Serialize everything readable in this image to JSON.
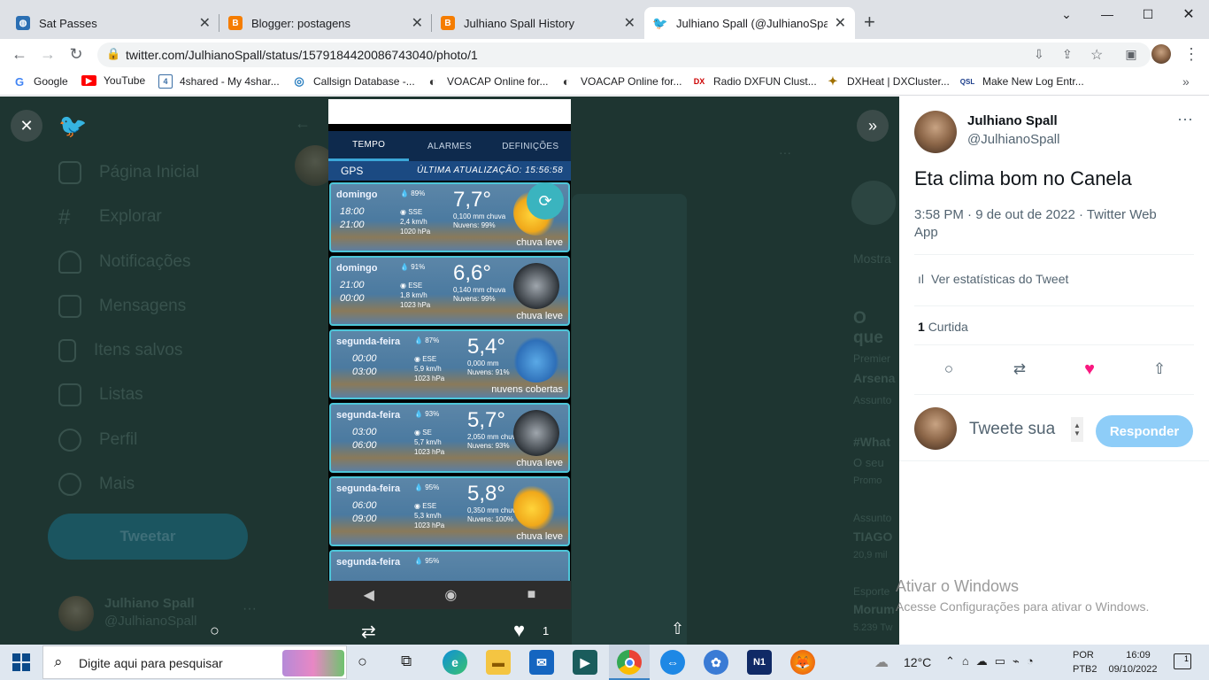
{
  "browser": {
    "tabs": [
      {
        "title": "Sat Passes",
        "icon": "globe-icon"
      },
      {
        "title": "Blogger: postagens",
        "icon": "blogger-icon"
      },
      {
        "title": "Julhiano Spall History",
        "icon": "blogger-icon"
      },
      {
        "title": "Julhiano Spall (@JulhianoSpall) /",
        "icon": "twitter-icon",
        "active": true
      }
    ],
    "new_tab": "+",
    "url": "twitter.com/JulhianoSpall/status/1579184420086743040/photo/1",
    "bookmarks": [
      {
        "label": "Google",
        "icon": "G"
      },
      {
        "label": "YouTube",
        "icon": "▶"
      },
      {
        "label": "4shared - My 4shar...",
        "icon": "4"
      },
      {
        "label": "Callsign Database -...",
        "icon": "◎"
      },
      {
        "label": "VOACAP Online for...",
        "icon": "◐"
      },
      {
        "label": "VOACAP Online for...",
        "icon": "◐"
      },
      {
        "label": "Radio DXFUN Clust...",
        "icon": "DX"
      },
      {
        "label": "DXHeat | DXCluster...",
        "icon": "✦"
      },
      {
        "label": "Make New Log Entr...",
        "icon": "QSL"
      }
    ]
  },
  "twitter_bg": {
    "nav": [
      "Página Inicial",
      "Explorar",
      "Notificações",
      "Mensagens",
      "Itens salvos",
      "Listas",
      "Perfil",
      "Mais"
    ],
    "tweet_button": "Tweetar",
    "account_name": "Julhiano Spall",
    "account_handle": "@JulhianoSpall",
    "right_fragments": [
      "Mostra",
      "O que",
      "Premier",
      "Arsena",
      "Assunto",
      "#What",
      "O seu",
      "Promo",
      "Assunto",
      "TIAGO",
      "20,9 mil",
      "Esporte",
      "Morum",
      "5.239 Tw"
    ]
  },
  "photo_actions": {
    "likes": "1"
  },
  "weather_app": {
    "tabs": [
      "TEMPO",
      "ALARMES",
      "DEFINIÇÕES"
    ],
    "gps_label": "GPS",
    "last_update": "ÚLTIMA ATUALIZAÇÃO: 15:56:58",
    "forecasts": [
      {
        "day": "domingo",
        "from": "18:00",
        "to": "21:00",
        "humidity": "89%",
        "wind_dir": "SSE",
        "wind_speed": "2,4 km/h",
        "pressure": "1020 hPa",
        "temp": "7,7°",
        "rain": "0,100 mm chuva",
        "clouds": "Nuvens: 99%",
        "condition": "chuva leve",
        "icon": "sun-rain-icon"
      },
      {
        "day": "domingo",
        "from": "21:00",
        "to": "00:00",
        "humidity": "91%",
        "wind_dir": "ESE",
        "wind_speed": "1,8 km/h",
        "pressure": "1023 hPa",
        "temp": "6,6°",
        "rain": "0,140 mm chuva",
        "clouds": "Nuvens: 99%",
        "condition": "chuva leve",
        "icon": "moon-rain-icon"
      },
      {
        "day": "segunda-feira",
        "from": "00:00",
        "to": "03:00",
        "humidity": "87%",
        "wind_dir": "ESE",
        "wind_speed": "5,9 km/h",
        "pressure": "1023 hPa",
        "temp": "5,4°",
        "rain": "0,000 mm",
        "clouds": "Nuvens: 91%",
        "condition": "nuvens cobertas",
        "icon": "clouds-icon"
      },
      {
        "day": "segunda-feira",
        "from": "03:00",
        "to": "06:00",
        "humidity": "93%",
        "wind_dir": "SE",
        "wind_speed": "5,7 km/h",
        "pressure": "1023 hPa",
        "temp": "5,7°",
        "rain": "2,050 mm chuva",
        "clouds": "Nuvens: 93%",
        "condition": "chuva leve",
        "icon": "moon-rain-icon"
      },
      {
        "day": "segunda-feira",
        "from": "06:00",
        "to": "09:00",
        "humidity": "95%",
        "wind_dir": "ESE",
        "wind_speed": "5,3 km/h",
        "pressure": "1023 hPa",
        "temp": "5,8°",
        "rain": "0,350 mm chuva",
        "clouds": "Nuvens: 100%",
        "condition": "chuva leve",
        "icon": "sun-rain-icon"
      }
    ],
    "partial": {
      "day": "segunda-feira",
      "humidity": "95%"
    }
  },
  "tweet": {
    "name": "Julhiano Spall",
    "handle": "@JulhianoSpall",
    "text": "Eta clima bom no Canela",
    "meta": "3:58 PM · 9 de out de 2022 · Twitter Web App",
    "analytics": "Ver estatísticas do Tweet",
    "likes_count": "1",
    "likes_label": "Curtida",
    "reply_placeholder": "Tweete sua",
    "reply_button": "Responder"
  },
  "watermark": {
    "line1": "Ativar o Windows",
    "line2": "Acesse Configurações para ativar o Windows."
  },
  "taskbar": {
    "search": "Digite aqui para pesquisar",
    "temperature": "12°C",
    "lang": "POR",
    "layout": "PTB2",
    "time": "16:09",
    "date": "09/10/2022",
    "notifications": "1"
  }
}
